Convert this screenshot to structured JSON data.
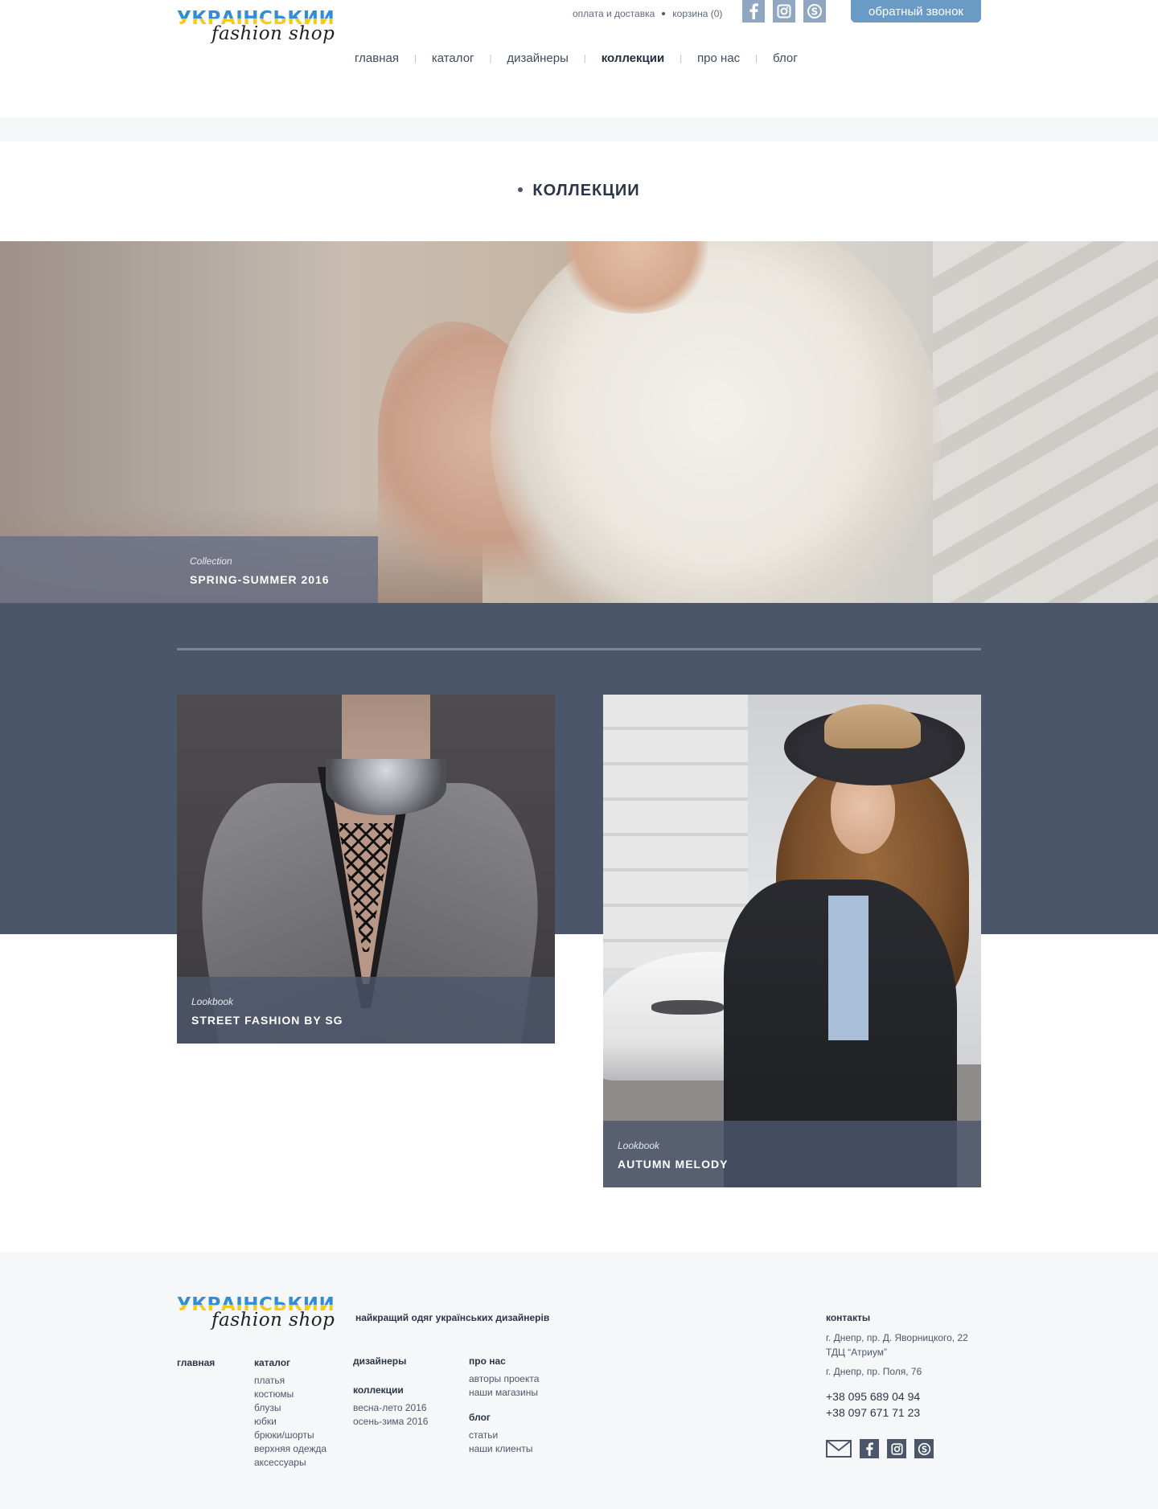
{
  "header": {
    "logo_line1": "УКРАЇНСЬКИЙ",
    "logo_line2": "fashion shop",
    "top_links": [
      "оплата и доставка",
      "корзина (0)"
    ],
    "social_icons": [
      "facebook-icon",
      "instagram-icon",
      "skype-icon"
    ],
    "callback_label": "обратный звонок",
    "nav": [
      "главная",
      "каталог",
      "дизайнеры",
      "коллекции",
      "про нас",
      "блог"
    ],
    "nav_active": "коллекции",
    "accent_color": "#6a9bc4"
  },
  "page": {
    "title": "КОЛЛЕКЦИИ"
  },
  "hero": {
    "subtitle": "Collection",
    "title": "SPRING-SUMMER 2016"
  },
  "cards": [
    {
      "subtitle": "Lookbook",
      "title": "STREET FASHION BY SG"
    },
    {
      "subtitle": "Lookbook",
      "title": "AUTUMN MELODY"
    }
  ],
  "footer": {
    "logo_line1": "УКРАЇНСЬКИЙ",
    "logo_line2": "fashion shop",
    "tagline": "найкращий одяг українських дизайнерів",
    "col_main": {
      "heading": "главная"
    },
    "col_catalog": {
      "heading": "каталог",
      "items": [
        "платья",
        "костюмы",
        "блузы",
        "юбки",
        "брюки/шорты",
        "верхняя одежда",
        "аксессуары"
      ]
    },
    "col_designers": {
      "heading": "дизайнеры"
    },
    "col_collections": {
      "heading": "коллекции",
      "items": [
        "весна-лето 2016",
        "осень-зима 2016"
      ]
    },
    "col_about": {
      "heading": "про нас",
      "items": [
        "авторы проекта",
        "наши магазины"
      ]
    },
    "col_blog": {
      "heading": "блог",
      "items": [
        "статьи",
        "наши клиенты"
      ]
    },
    "contacts": {
      "heading": "контакты",
      "address1": "г. Днепр, пр. Д. Яворницкого, 22",
      "address1b": "ТДЦ “Атриум”",
      "address2": "г. Днепр, пр. Поля, 76",
      "phones": [
        "+38 095 689 04 94",
        "+38 097 671 71 23"
      ]
    },
    "social_icons": [
      "mail-icon",
      "facebook-icon",
      "instagram-icon",
      "skype-icon"
    ]
  }
}
